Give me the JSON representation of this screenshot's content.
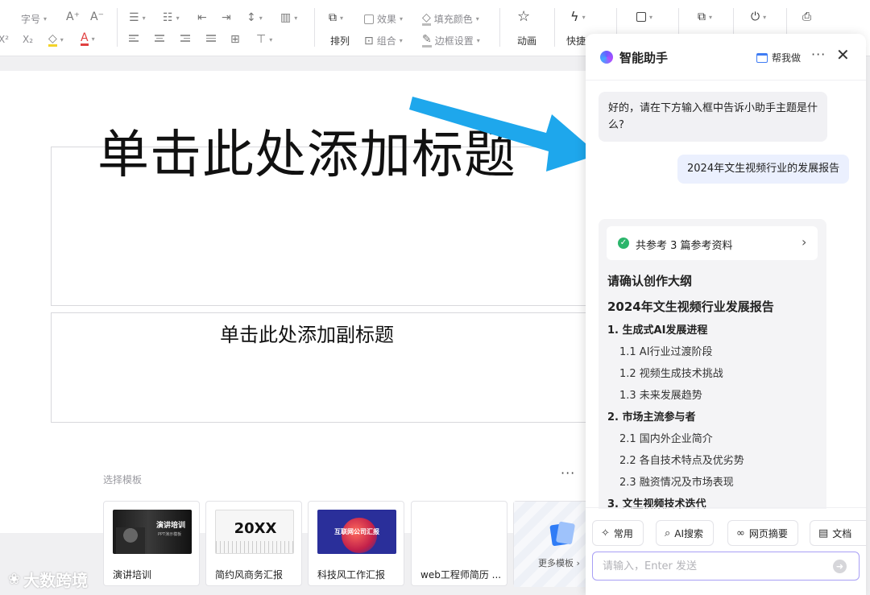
{
  "toolbar": {
    "font_size_label": "字号",
    "superscript": "X²",
    "subscript": "X₂",
    "arrange_label": "排列",
    "effect_label": "效果",
    "group_label": "组合",
    "fill_color_label": "填充颜色",
    "border_label": "边框设置",
    "animation_label": "动画",
    "quick_label": "快捷",
    "highlight_color": "#f3d32a",
    "font_color": "#e04040"
  },
  "slide": {
    "title_placeholder": "单击此处添加标题",
    "subtitle_placeholder": "单击此处添加副标题"
  },
  "templates": {
    "label": "选择模板",
    "more_label": "更多模板",
    "items": [
      {
        "name": "演讲培训",
        "thumb_title": "演讲培训",
        "thumb_sub": "PPT演示模板"
      },
      {
        "name": "简约风商务汇报",
        "thumb_title": "20XX"
      },
      {
        "name": "科技风工作汇报",
        "thumb_title": "互联网公司汇报"
      },
      {
        "name": "web工程师简历 ..."
      }
    ]
  },
  "watermark": {
    "text": "大数跨境"
  },
  "assistant": {
    "title": "智能助手",
    "help_label": "帮我做",
    "messages": {
      "bot_prompt": "好的，请在下方输入框中告诉小助手主题是什么?",
      "user_topic": "2024年文生视频行业的发展报告"
    },
    "references": "共参考 3 篇参考资料",
    "outline": {
      "heading": "请确认创作大纲",
      "title": "2024年文生视频行业发展报告",
      "sections": [
        {
          "label": "1. 生成式AI发展进程",
          "subs": [
            "1.1 AI行业过渡阶段",
            "1.2 视频生成技术挑战",
            "1.3 未来发展趋势"
          ]
        },
        {
          "label": "2. 市场主流参与者",
          "subs": [
            "2.1 国内外企业简介",
            "2.2 各自技术特点及优劣势",
            "2.3 融资情况及市场表现"
          ]
        },
        {
          "label": "3. 文生视频技术迭代",
          "subs": []
        }
      ]
    },
    "quick_actions": [
      "常用",
      "AI搜索",
      "网页摘要",
      "文档"
    ],
    "input_placeholder": "请输入，Enter 发送"
  },
  "colors": {
    "accent": "#3f7cf4",
    "arrow": "#1ea7ec",
    "success": "#2bb56b"
  }
}
